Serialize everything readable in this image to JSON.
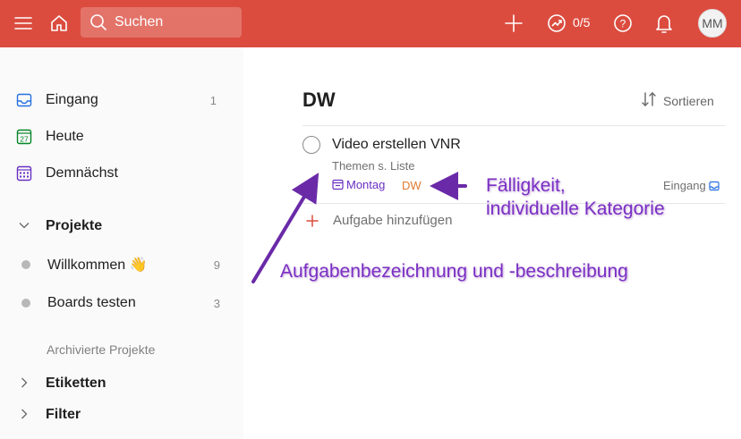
{
  "topbar": {
    "search_label": "Suchen",
    "karma_progress": "0/5",
    "avatar_initials": "MM",
    "accent_color": "#db4c3f"
  },
  "sidebar": {
    "items": [
      {
        "label": "Eingang",
        "count": "1",
        "icon": "inbox-icon"
      },
      {
        "label": "Heute",
        "count": "",
        "icon": "calendar-today-icon",
        "icon_text": "27"
      },
      {
        "label": "Demnächst",
        "count": "",
        "icon": "calendar-upcoming-icon"
      }
    ],
    "projects_header": "Projekte",
    "projects": [
      {
        "label": "Willkommen",
        "emoji": "👋",
        "count": "9"
      },
      {
        "label": "Boards testen",
        "count": "3"
      }
    ],
    "archived_label": "Archivierte Projekte",
    "labels_header": "Etiketten",
    "filters_header": "Filter"
  },
  "main": {
    "title": "DW",
    "sort_label": "Sortieren",
    "task": {
      "title": "Video erstellen VNR",
      "description": "Themen s. Liste",
      "due_label": "Montag",
      "label_tag": "DW",
      "project": "Eingang"
    },
    "add_task_label": "Aufgabe hinzufügen"
  },
  "annotations": {
    "due_line1": "Fälligkeit,",
    "due_line2": "individuelle Kategorie",
    "task_desc": "Aufgabenbezeichnung und -beschreibung",
    "color": "#7a2fc4"
  }
}
